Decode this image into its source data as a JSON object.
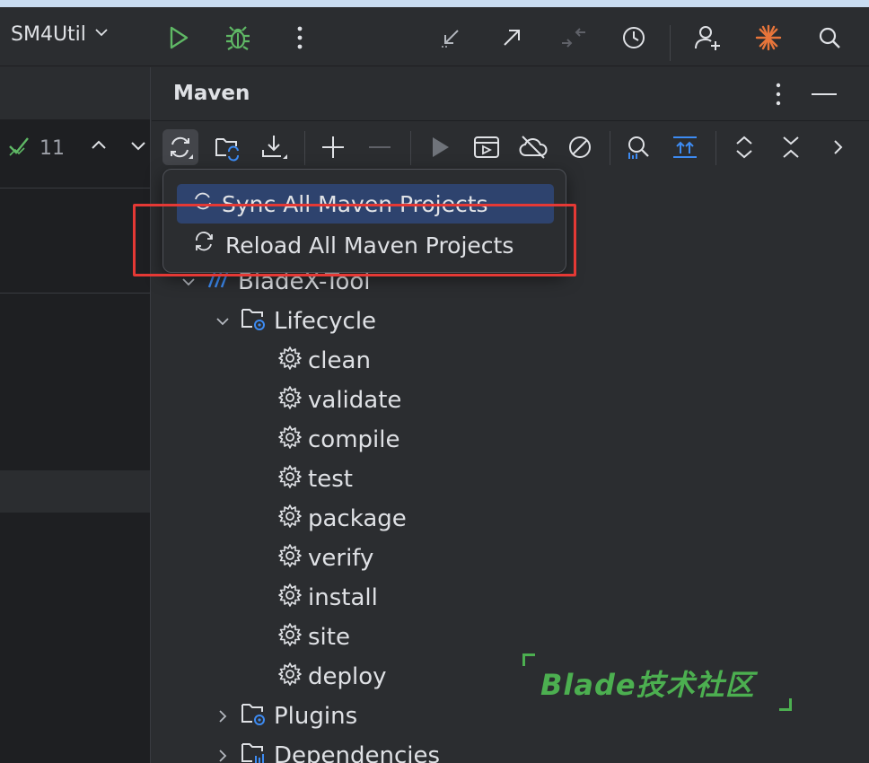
{
  "titlebar": {
    "project_name": "SM4Util"
  },
  "left": {
    "match_count": "11"
  },
  "maven": {
    "title": "Maven"
  },
  "popup": {
    "items": [
      {
        "label": "Sync All Maven Projects"
      },
      {
        "label": "Reload All Maven Projects"
      }
    ]
  },
  "tree": {
    "project": "BladeX-Tool",
    "lifecycle": "Lifecycle",
    "goals": [
      "clean",
      "validate",
      "compile",
      "test",
      "package",
      "verify",
      "install",
      "site",
      "deploy"
    ],
    "plugins": "Plugins",
    "dependencies": "Dependencies"
  },
  "watermark": {
    "text": "Blade技术社区"
  },
  "colors": {
    "accent_selection": "#2e436e",
    "highlight_box": "#e53935",
    "run_green": "#5fb865",
    "ai_orange": "#e8753a",
    "watermark_green": "#4caf50"
  }
}
